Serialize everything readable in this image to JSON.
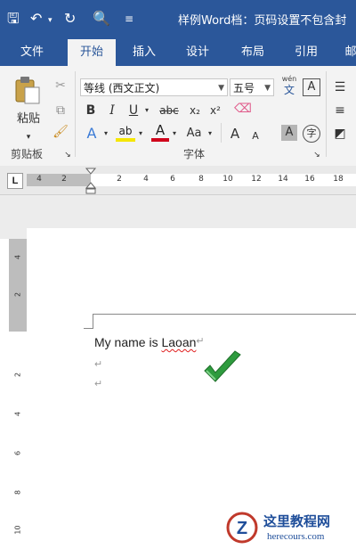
{
  "title_bar": {
    "title": "样例Word档：页码设置不包含封"
  },
  "tabs": [
    {
      "label": "文件"
    },
    {
      "label": "开始"
    },
    {
      "label": "插入"
    },
    {
      "label": "设计"
    },
    {
      "label": "布局"
    },
    {
      "label": "引用"
    },
    {
      "label": "邮"
    }
  ],
  "clipboard": {
    "paste_label": "粘贴",
    "group_label": "剪贴板"
  },
  "font": {
    "font_name": "等线 (西文正文)",
    "font_size": "五号",
    "group_label": "字体",
    "pinyin_label": "wén",
    "pinyin_char": "文",
    "bold": "B",
    "italic": "I",
    "underline": "U",
    "strike": "abc",
    "subscript": "x₂",
    "superscript": "x²",
    "grow": "A",
    "shrink": "A",
    "case": "Aa",
    "boxchar": "A",
    "encircle": "字",
    "effects": "A",
    "highlight": "ab",
    "fontcolor": "A",
    "shade": "A"
  },
  "ruler": {
    "tab_selector": "L",
    "ticks": [
      "4",
      "2",
      "2",
      "4",
      "6",
      "8",
      "10",
      "12",
      "14",
      "16",
      "18"
    ],
    "vticks": [
      "4",
      "2",
      "2",
      "4",
      "6",
      "8",
      "10"
    ]
  },
  "document": {
    "line1_text": "My name is ",
    "line1_word": "Laoan",
    "para_mark": "↵"
  },
  "watermark": {
    "site": "这里教程网",
    "url": "herecours.com",
    "logo_letter": "Z"
  },
  "colors": {
    "brand_blue": "#2b579a",
    "ribbon": "#f3f3f3",
    "check_green": "#2e9b3e",
    "highlight_yellow": "#f5e600",
    "font_red": "#d0021b"
  }
}
